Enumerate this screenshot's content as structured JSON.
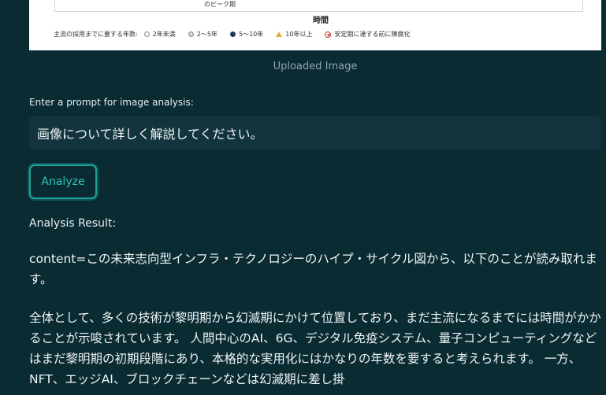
{
  "image_preview": {
    "peak_label": "のピーク期",
    "axis_label": "時間",
    "legend": {
      "title": "主流の採用までに要する年数:",
      "items": [
        {
          "marker": "open-circle",
          "label": "2年未満"
        },
        {
          "marker": "grey-circle",
          "label": "2～5年"
        },
        {
          "marker": "dark-circle",
          "label": "5～10年"
        },
        {
          "marker": "yellow-triangle",
          "label": "10年以上"
        },
        {
          "marker": "crossed-circle",
          "label": "安定期に達する前に陳腐化"
        }
      ]
    },
    "caption": "Uploaded Image"
  },
  "prompt": {
    "label": "Enter a prompt for image analysis:",
    "value": "画像について詳しく解説してください。"
  },
  "analyze_button": {
    "label": "Analyze"
  },
  "result": {
    "label": "Analysis Result:",
    "paragraph1": "content=この未来志向型インフラ・テクノロジーのハイプ・サイクル図から、以下のことが読み取れます。",
    "paragraph2": "全体として、多くの技術が黎明期から幻滅期にかけて位置しており、まだ主流になるまでには時間がかかることが示唆されています。 人間中心のAI、6G、デジタル免疫システム、量子コンピューティングなどはまだ黎明期の初期段階にあり、本格的な実用化にはかなりの年数を要すると考えられます。 一方、NFT、エッジAI、ブロックチェーンなどは幻滅期に差し掛"
  },
  "colors": {
    "background": "#0b2b33",
    "accent": "#1ea39a",
    "input_bg": "#13343d"
  }
}
